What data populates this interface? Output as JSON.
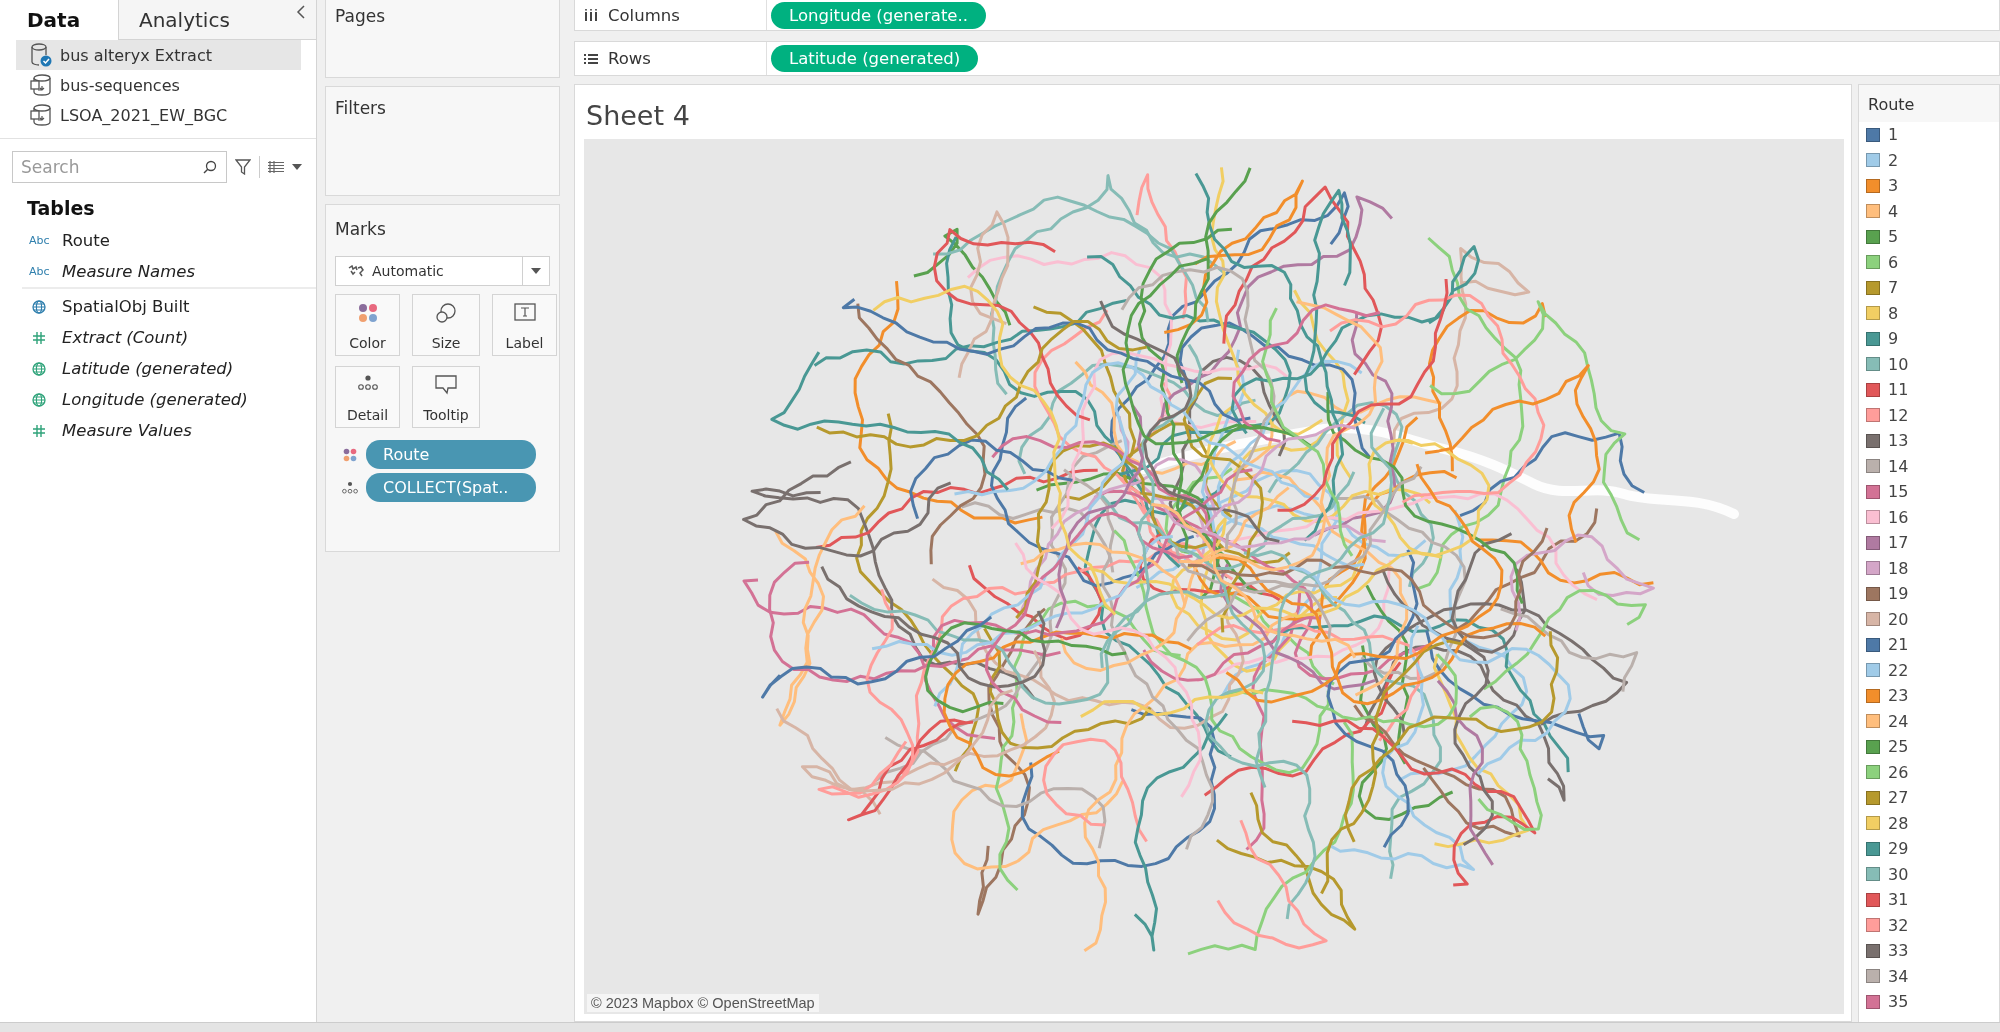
{
  "sidebar": {
    "tabs": [
      {
        "label": "Data",
        "selected": true
      },
      {
        "label": "Analytics",
        "selected": false
      }
    ],
    "data_sources": [
      {
        "name": "bus alteryx Extract",
        "kind": "extract",
        "selected": true
      },
      {
        "name": "bus-sequences",
        "kind": "source",
        "selected": false
      },
      {
        "name": "LSOA_2021_EW_BGC",
        "kind": "source",
        "selected": false
      }
    ],
    "search": {
      "placeholder": "Search"
    },
    "tables_heading": "Tables",
    "field_groups": [
      [
        {
          "name": "Route",
          "kind": "string",
          "badge": "Abc",
          "italic": false
        },
        {
          "name": "Measure Names",
          "kind": "string",
          "badge": "Abc",
          "italic": true
        }
      ],
      [
        {
          "name": "SpatialObj Built",
          "kind": "spatial",
          "italic": false
        },
        {
          "name": "Extract (Count)",
          "kind": "number",
          "italic": true
        },
        {
          "name": "Latitude (generated)",
          "kind": "geographic",
          "italic": true
        },
        {
          "name": "Longitude (generated)",
          "kind": "geographic",
          "italic": true
        },
        {
          "name": "Measure Values",
          "kind": "number",
          "italic": true
        }
      ]
    ]
  },
  "pages": {
    "title": "Pages"
  },
  "filters": {
    "title": "Filters"
  },
  "marks": {
    "title": "Marks",
    "mark_type": "Automatic",
    "cards": [
      {
        "label": "Color",
        "kind": "color"
      },
      {
        "label": "Size",
        "kind": "size"
      },
      {
        "label": "Label",
        "kind": "label"
      },
      {
        "label": "Detail",
        "kind": "detail"
      },
      {
        "label": "Tooltip",
        "kind": "tooltip"
      }
    ],
    "pills": [
      {
        "label": "Route",
        "kind": "color"
      },
      {
        "label": "COLLECT(Spat..",
        "kind": "detail"
      }
    ]
  },
  "columns": {
    "label": "Columns",
    "pills": [
      "Longitude (generate.."
    ]
  },
  "rows": {
    "label": "Rows",
    "pills": [
      "Latitude (generated)"
    ]
  },
  "view": {
    "title": "Sheet 4",
    "attribution": "© 2023 Mapbox © OpenStreetMap"
  },
  "legend": {
    "title": "Route",
    "items": [
      {
        "label": "1",
        "color": "#4e79a7"
      },
      {
        "label": "2",
        "color": "#a0cbe8"
      },
      {
        "label": "3",
        "color": "#f28e2b"
      },
      {
        "label": "4",
        "color": "#ffbe7d"
      },
      {
        "label": "5",
        "color": "#59a14f"
      },
      {
        "label": "6",
        "color": "#8cd17d"
      },
      {
        "label": "7",
        "color": "#b6992d"
      },
      {
        "label": "8",
        "color": "#f1ce63"
      },
      {
        "label": "9",
        "color": "#499894"
      },
      {
        "label": "10",
        "color": "#86bcb6"
      },
      {
        "label": "11",
        "color": "#e15759"
      },
      {
        "label": "12",
        "color": "#ff9d9a"
      },
      {
        "label": "13",
        "color": "#79706e"
      },
      {
        "label": "14",
        "color": "#bab0ac"
      },
      {
        "label": "15",
        "color": "#d37295"
      },
      {
        "label": "16",
        "color": "#fabfd2"
      },
      {
        "label": "17",
        "color": "#b07aa1"
      },
      {
        "label": "18",
        "color": "#d4a6c8"
      },
      {
        "label": "19",
        "color": "#9d7660"
      },
      {
        "label": "20",
        "color": "#d7b5a6"
      },
      {
        "label": "21",
        "color": "#4e79a7"
      },
      {
        "label": "22",
        "color": "#a0cbe8"
      },
      {
        "label": "23",
        "color": "#f28e2b"
      },
      {
        "label": "24",
        "color": "#ffbe7d"
      },
      {
        "label": "25",
        "color": "#59a14f"
      },
      {
        "label": "26",
        "color": "#8cd17d"
      },
      {
        "label": "27",
        "color": "#b6992d"
      },
      {
        "label": "28",
        "color": "#f1ce63"
      },
      {
        "label": "29",
        "color": "#499894"
      },
      {
        "label": "30",
        "color": "#86bcb6"
      },
      {
        "label": "31",
        "color": "#e15759"
      },
      {
        "label": "32",
        "color": "#ff9d9a"
      },
      {
        "label": "33",
        "color": "#79706e"
      },
      {
        "label": "34",
        "color": "#bab0ac"
      },
      {
        "label": "35",
        "color": "#d37295"
      }
    ]
  }
}
